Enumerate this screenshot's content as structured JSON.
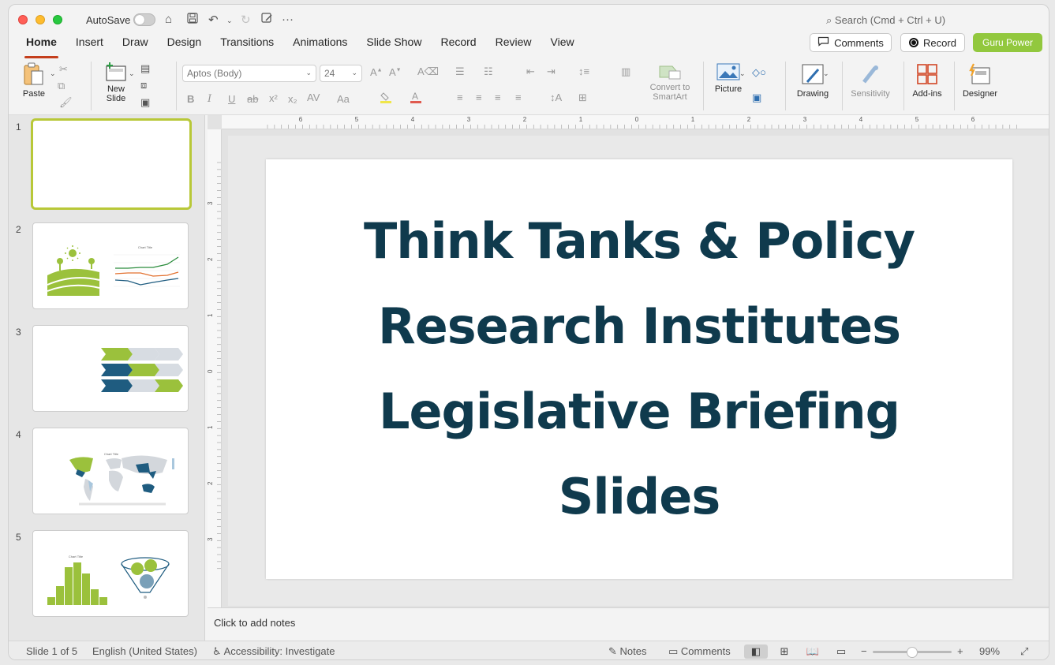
{
  "titlebar": {
    "autosave_label": "AutoSave",
    "search_placeholder": "Search (Cmd + Ctrl + U)",
    "more_label": "···"
  },
  "tabs": [
    "Home",
    "Insert",
    "Draw",
    "Design",
    "Transitions",
    "Animations",
    "Slide Show",
    "Record",
    "Review",
    "View"
  ],
  "header_buttons": {
    "comments": "Comments",
    "record": "Record",
    "guru": "Guru Power"
  },
  "ribbon": {
    "paste": "Paste",
    "new_slide_1": "New",
    "new_slide_2": "Slide",
    "font_name": "Aptos (Body)",
    "font_size": "24",
    "convert_1": "Convert to",
    "convert_2": "SmartArt",
    "picture": "Picture",
    "drawing": "Drawing",
    "sensitivity": "Sensitivity",
    "addins": "Add-ins",
    "designer": "Designer"
  },
  "thumbnails": [
    "1",
    "2",
    "3",
    "4",
    "5"
  ],
  "thumb_chart_title": "Chart Title",
  "slide": {
    "title_lines": [
      "Think Tanks & Policy",
      "Research Institutes",
      "Legislative Briefing",
      "Slides"
    ]
  },
  "ruler_h": [
    "6",
    "5",
    "4",
    "3",
    "2",
    "1",
    "0",
    "1",
    "2",
    "3",
    "4",
    "5",
    "6"
  ],
  "ruler_v": [
    "3",
    "2",
    "1",
    "0",
    "1",
    "2",
    "3"
  ],
  "notes_placeholder": "Click to add notes",
  "status": {
    "slide_counter": "Slide 1 of 5",
    "language": "English (United States)",
    "accessibility": "Accessibility: Investigate",
    "notes": "Notes",
    "comments": "Comments",
    "zoom": "99%"
  },
  "colors": {
    "accent_green": "#92c83e",
    "title_navy": "#0f3a4d",
    "tab_underline": "#c43e1c",
    "chart_blue": "#1f5c80"
  }
}
